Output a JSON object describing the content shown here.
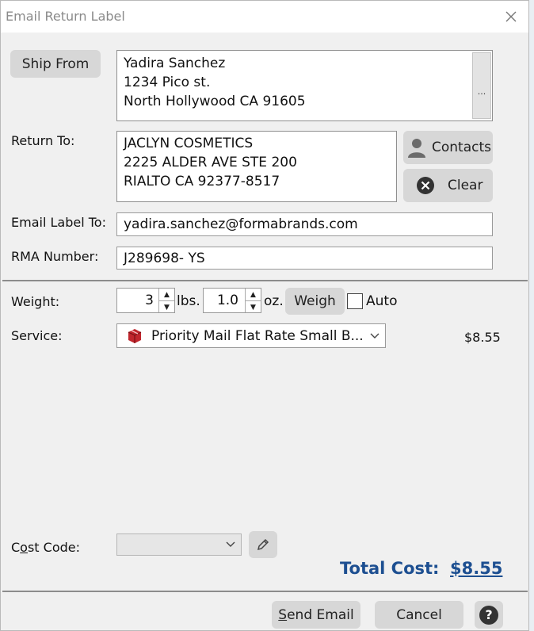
{
  "window": {
    "title": "Email Return Label"
  },
  "ship_from": {
    "button_label": "Ship From",
    "lines": [
      "Yadira Sanchez",
      "1234 Pico st.",
      "North Hollywood CA 91605"
    ],
    "more_label": "..."
  },
  "return_to": {
    "label": "Return To:",
    "lines": [
      "JACLYN COSMETICS",
      "2225 ALDER AVE STE 200",
      "RIALTO CA 92377-8517"
    ],
    "contacts_label": "Contacts",
    "clear_label": "Clear"
  },
  "email": {
    "label": "Email Label To:",
    "value": "yadira.sanchez@formabrands.com"
  },
  "rma": {
    "label": "RMA Number:",
    "value": "J289698- YS"
  },
  "weight": {
    "label": "Weight:",
    "lbs_value": "3",
    "lbs_unit": "lbs.",
    "oz_value": "1.0",
    "oz_unit": "oz.",
    "weigh_label": "Weigh",
    "auto_label": "Auto",
    "auto_checked": false
  },
  "service": {
    "label": "Service:",
    "selected": "Priority Mail Flat Rate Small B...",
    "price": "$8.55",
    "icon": "package-icon",
    "icon_color": "#c0262d"
  },
  "cost_code": {
    "label_pre": "C",
    "label_accel": "o",
    "label_post": "st Code:",
    "selected": ""
  },
  "total": {
    "label": "Total Cost:",
    "value": "$8.55",
    "color": "#1d4f91"
  },
  "footer": {
    "send_pre": "",
    "send_accel": "S",
    "send_post": "end Email",
    "cancel_label": "Cancel",
    "help_label": "?"
  }
}
